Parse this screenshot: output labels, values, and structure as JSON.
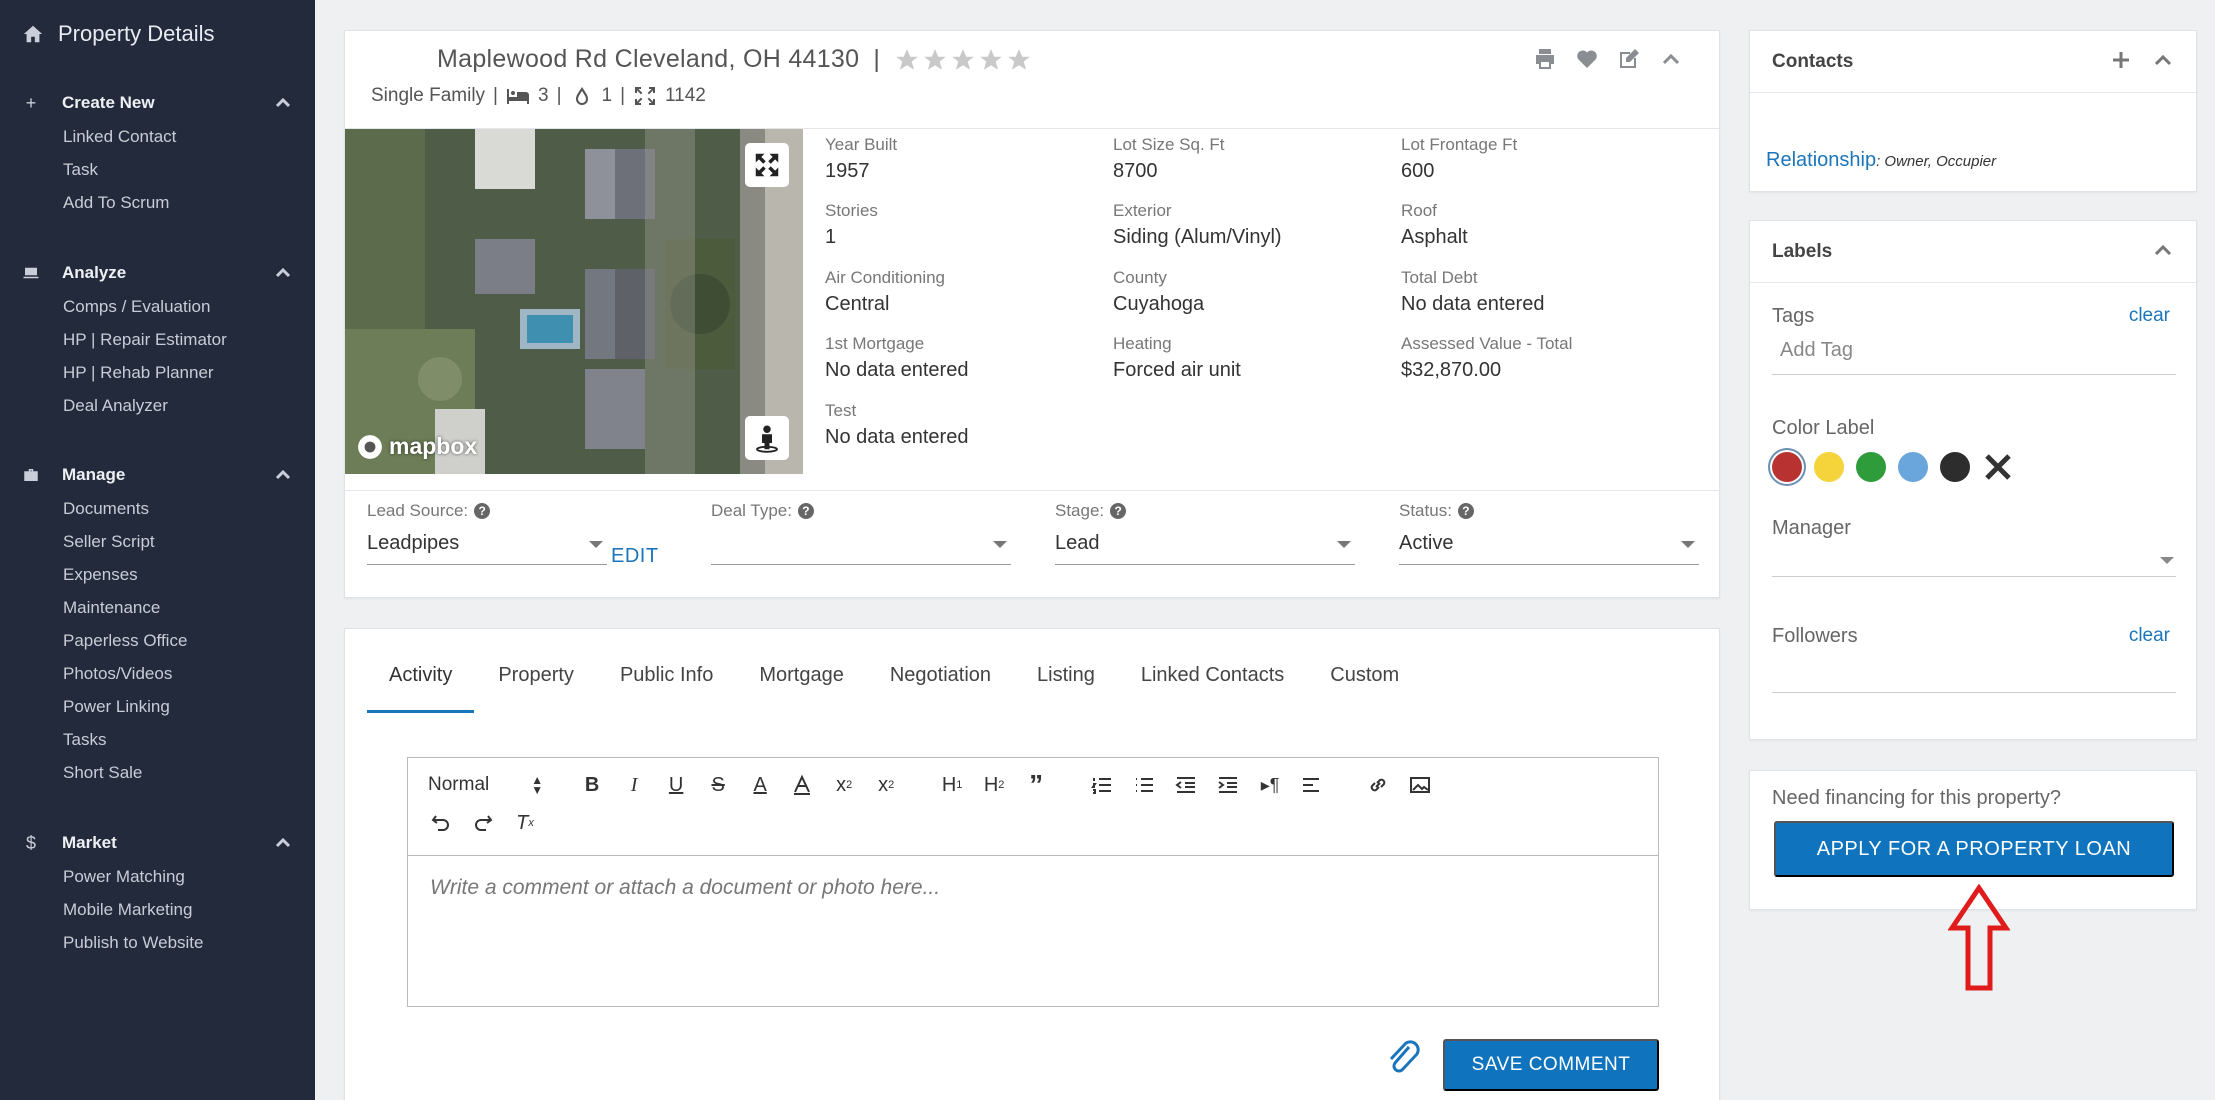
{
  "sidebar": {
    "title": "Property Details",
    "sections": [
      {
        "title": "Create New",
        "items": [
          "Linked Contact",
          "Task",
          "Add To Scrum"
        ]
      },
      {
        "title": "Analyze",
        "items": [
          "Comps / Evaluation",
          "HP | Repair Estimator",
          "HP | Rehab Planner",
          "Deal Analyzer"
        ]
      },
      {
        "title": "Manage",
        "items": [
          "Documents",
          "Seller Script",
          "Expenses",
          "Maintenance",
          "Paperless Office",
          "Photos/Videos",
          "Power Linking",
          "Tasks",
          "Short Sale"
        ]
      },
      {
        "title": "Market",
        "items": [
          "Power Matching",
          "Mobile Marketing",
          "Publish to Website"
        ]
      }
    ]
  },
  "property": {
    "address": "Maplewood Rd Cleveland, OH 44130",
    "separator": "|",
    "type": "Single Family",
    "beds": "3",
    "baths": "1",
    "sqft": "1142",
    "map_attribution": "mapbox",
    "facts": {
      "year_built": {
        "label": "Year Built",
        "value": "1957"
      },
      "lot_size": {
        "label": "Lot Size Sq. Ft",
        "value": "8700"
      },
      "lot_frontage": {
        "label": "Lot Frontage Ft",
        "value": "600"
      },
      "stories": {
        "label": "Stories",
        "value": "1"
      },
      "exterior": {
        "label": "Exterior",
        "value": "Siding (Alum/Vinyl)"
      },
      "roof": {
        "label": "Roof",
        "value": "Asphalt"
      },
      "air": {
        "label": "Air Conditioning",
        "value": "Central"
      },
      "county": {
        "label": "County",
        "value": "Cuyahoga"
      },
      "total_debt": {
        "label": "Total Debt",
        "value": "No data entered"
      },
      "mortgage": {
        "label": "1st Mortgage",
        "value": "No data entered"
      },
      "heating": {
        "label": "Heating",
        "value": "Forced air unit"
      },
      "assessed": {
        "label": "Assessed Value - Total",
        "value": "$32,870.00"
      },
      "test": {
        "label": "Test",
        "value": "No data entered"
      }
    },
    "lead_source": {
      "label": "Lead Source:",
      "value": "Leadpipes"
    },
    "edit_label": "EDIT",
    "deal_type": {
      "label": "Deal Type:",
      "value": ""
    },
    "stage": {
      "label": "Stage:",
      "value": "Lead"
    },
    "status": {
      "label": "Status:",
      "value": "Active"
    }
  },
  "activity": {
    "tabs": [
      "Activity",
      "Property",
      "Public Info",
      "Mortgage",
      "Negotiation",
      "Listing",
      "Linked Contacts",
      "Custom"
    ],
    "active_tab": "Activity",
    "format_select": "Normal",
    "placeholder": "Write a comment or attach a document or photo here...",
    "save_label": "SAVE COMMENT"
  },
  "contacts": {
    "title": "Contacts",
    "relationship_label": "Relationship",
    "relationship_value": ": Owner, Occupier"
  },
  "labels": {
    "title": "Labels",
    "tags_label": "Tags",
    "clear_label": "clear",
    "tag_placeholder": "Add Tag",
    "color_label": "Color Label",
    "colors": [
      "#b83232",
      "#f5d33a",
      "#2e9c3a",
      "#6aa6dc",
      "#2d2d2d"
    ],
    "selected_color": "#b83232",
    "manager_label": "Manager",
    "followers_label": "Followers"
  },
  "financing": {
    "prompt": "Need financing for this property?",
    "button_label": "APPLY FOR A PROPERTY LOAN"
  }
}
